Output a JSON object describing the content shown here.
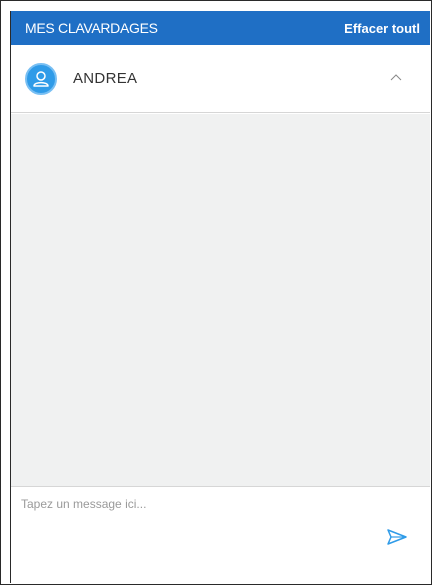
{
  "header": {
    "title": "MES CLAVARDAGES",
    "clear_label": "Effacer toutl"
  },
  "contact": {
    "name": "ANDREA",
    "avatar_icon": "user-icon",
    "toggle_icon": "chevron-up-icon"
  },
  "composer": {
    "placeholder": "Tapez un message ici...",
    "value": "",
    "send_icon": "send-icon"
  },
  "colors": {
    "header_bg": "#1f6fc5",
    "avatar_bg": "#2f9be8",
    "messages_bg": "#f0f1f1",
    "send_icon": "#2f9be8"
  }
}
